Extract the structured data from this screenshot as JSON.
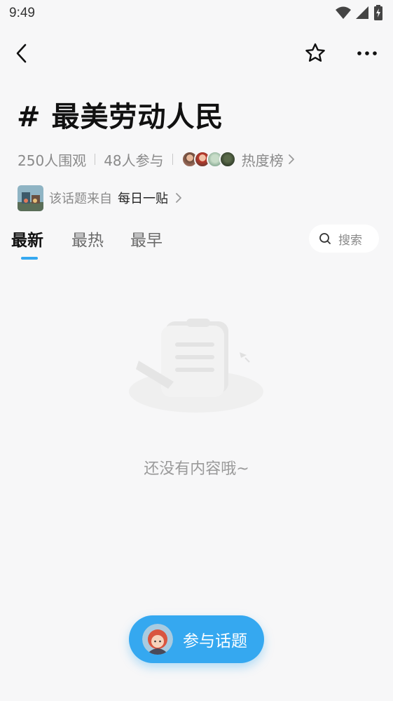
{
  "status": {
    "time": "9:49"
  },
  "topic": {
    "title": "# 最美劳动人民",
    "views": "250人围观",
    "participants": "48人参与",
    "ranking_label": "热度榜"
  },
  "source": {
    "label": "该话题来自",
    "name": "每日一贴"
  },
  "tabs": [
    {
      "label": "最新",
      "active": true
    },
    {
      "label": "最热",
      "active": false
    },
    {
      "label": "最早",
      "active": false
    }
  ],
  "search": {
    "label": "搜索"
  },
  "empty": {
    "message": "还没有内容哦~"
  },
  "join_button": {
    "label": "参与话题"
  },
  "colors": {
    "accent": "#35a8f0",
    "background": "#f7f7f8"
  },
  "icons": [
    "back-icon",
    "star-icon",
    "more-icon",
    "search-icon",
    "chevron-right-icon",
    "wifi-icon",
    "signal-icon",
    "battery-icon"
  ]
}
